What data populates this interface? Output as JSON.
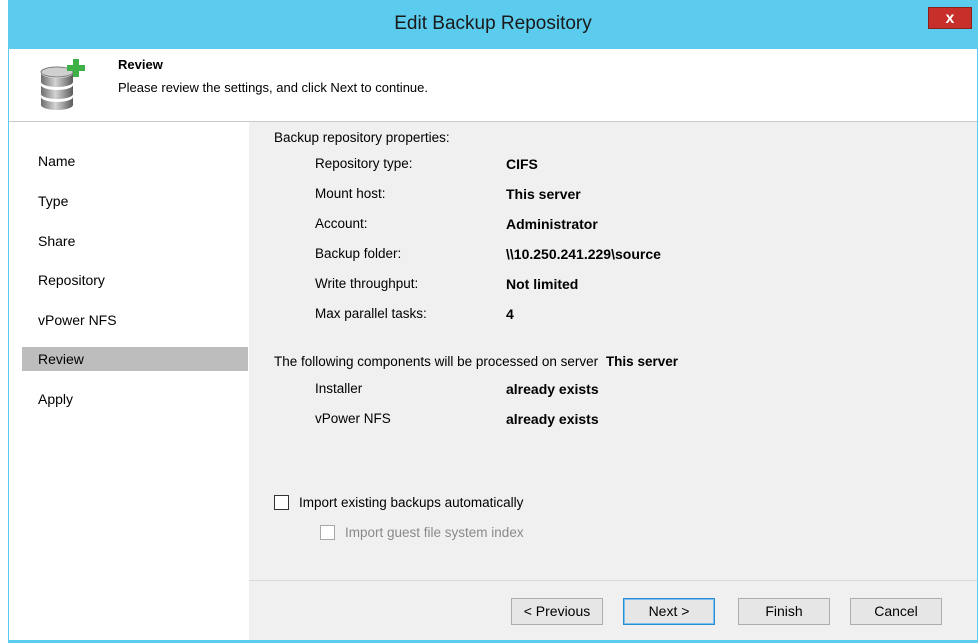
{
  "window": {
    "title": "Edit Backup Repository",
    "close_glyph": "x",
    "accent_color": "#5bcbee"
  },
  "header": {
    "icon": "database-add-icon",
    "title": "Review",
    "subtitle": "Please review the settings, and click Next to continue."
  },
  "sidebar": {
    "items": [
      {
        "label": "Name"
      },
      {
        "label": "Type"
      },
      {
        "label": "Share"
      },
      {
        "label": "Repository"
      },
      {
        "label": "vPower NFS"
      },
      {
        "label": "Review"
      },
      {
        "label": "Apply"
      }
    ],
    "active": "Review"
  },
  "review": {
    "section_title": "Backup repository properties:",
    "properties": [
      {
        "label": "Repository type:",
        "value": "CIFS"
      },
      {
        "label": "Mount host:",
        "value": "This server"
      },
      {
        "label": "Account:",
        "value": "Administrator"
      },
      {
        "label": "Backup folder:",
        "value": "\\\\10.250.241.229\\source"
      },
      {
        "label": "Write throughput:",
        "value": "Not limited"
      },
      {
        "label": "Max parallel tasks:",
        "value": "4"
      }
    ],
    "components_text": "The following components will be processed on server",
    "components_server": "This server",
    "components": [
      {
        "label": "Installer",
        "value": "already exists"
      },
      {
        "label": "vPower NFS",
        "value": "already exists"
      }
    ]
  },
  "options": {
    "import_backups": {
      "label": "Import existing backups automatically",
      "checked": false
    },
    "import_index": {
      "label": "Import guest file system index",
      "checked": false,
      "enabled": false
    }
  },
  "buttons": {
    "previous": "< Previous",
    "next": "Next >",
    "finish": "Finish",
    "cancel": "Cancel"
  }
}
